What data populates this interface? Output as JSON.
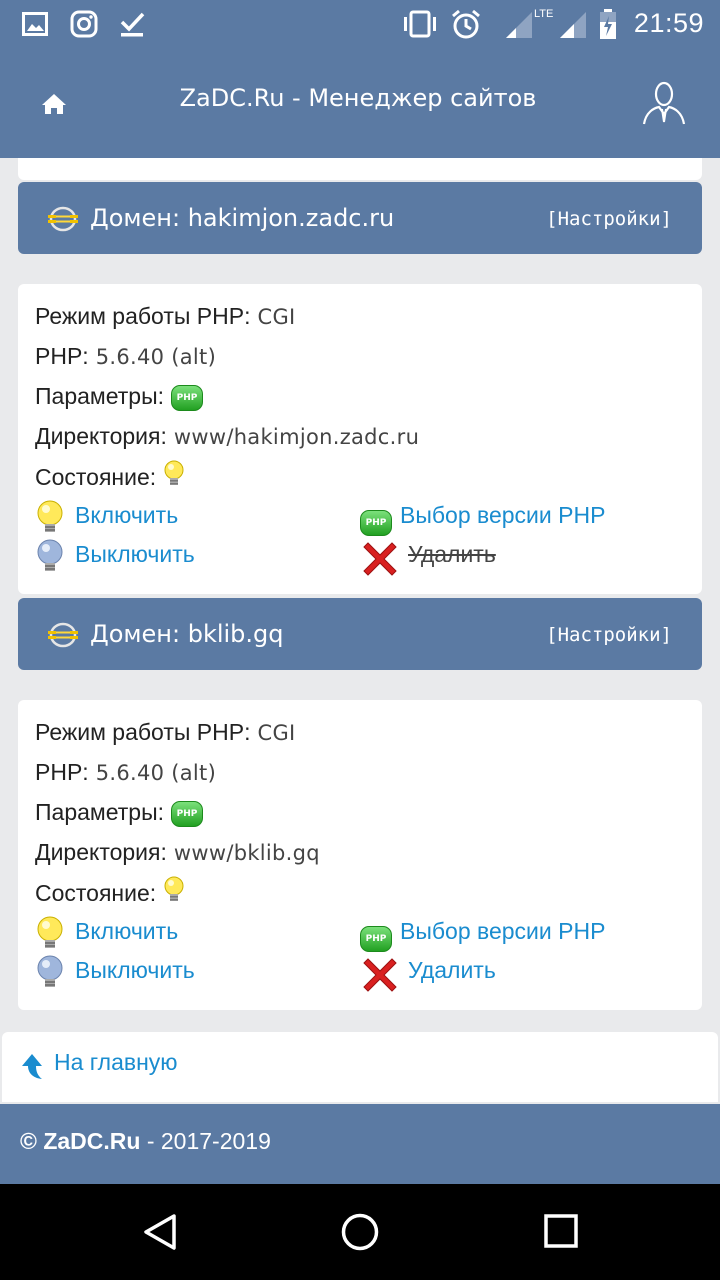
{
  "status_bar": {
    "time": "21:59",
    "network": "LTE",
    "left_icons": [
      "image-icon",
      "instagram-icon",
      "download-done-icon"
    ],
    "right_icons": [
      "vibrate-icon",
      "alarm-icon",
      "signal-icon",
      "battery-icon"
    ]
  },
  "header": {
    "title": "ZaDC.Ru - Менеджер сайтов",
    "home_icon": "home-icon",
    "user_icon": "user-profile-icon"
  },
  "domains": [
    {
      "title": "Домен: hakimjon.zadc.ru",
      "settings_label": "[Настройки]",
      "php_mode_label": "Режим работы PHP:",
      "php_mode_value": "CGI",
      "php_label": "PHP:",
      "php_value": "5.6.40 (alt)",
      "params_label": "Параметры:",
      "params_badge": "PHP",
      "dir_label": "Директория:",
      "dir_value": "www/hakimjon.zadc.ru",
      "state_label": "Состояние:",
      "enable_label": "Включить",
      "disable_label": "Выключить",
      "php_version_label": "Выбор версии PHP",
      "php_version_badge": "PHP",
      "delete_label": "Удалить",
      "delete_disabled": true
    },
    {
      "title": "Домен: bklib.gq",
      "settings_label": "[Настройки]",
      "php_mode_label": "Режим работы PHP:",
      "php_mode_value": "CGI",
      "php_label": "PHP:",
      "php_value": "5.6.40 (alt)",
      "params_label": "Параметры:",
      "params_badge": "PHP",
      "dir_label": "Директория:",
      "dir_value": "www/bklib.gq",
      "state_label": "Состояние:",
      "enable_label": "Включить",
      "disable_label": "Выключить",
      "php_version_label": "Выбор версии PHP",
      "php_version_badge": "PHP",
      "delete_label": "Удалить",
      "delete_disabled": false
    }
  ],
  "home_link": {
    "label": "На главную"
  },
  "footer": {
    "brand": "© ZaDC.Ru",
    "years": " - 2017-2019"
  },
  "colors": {
    "primary": "#5b7aa3",
    "link": "#1a8ccf",
    "background": "#e9eaec"
  }
}
